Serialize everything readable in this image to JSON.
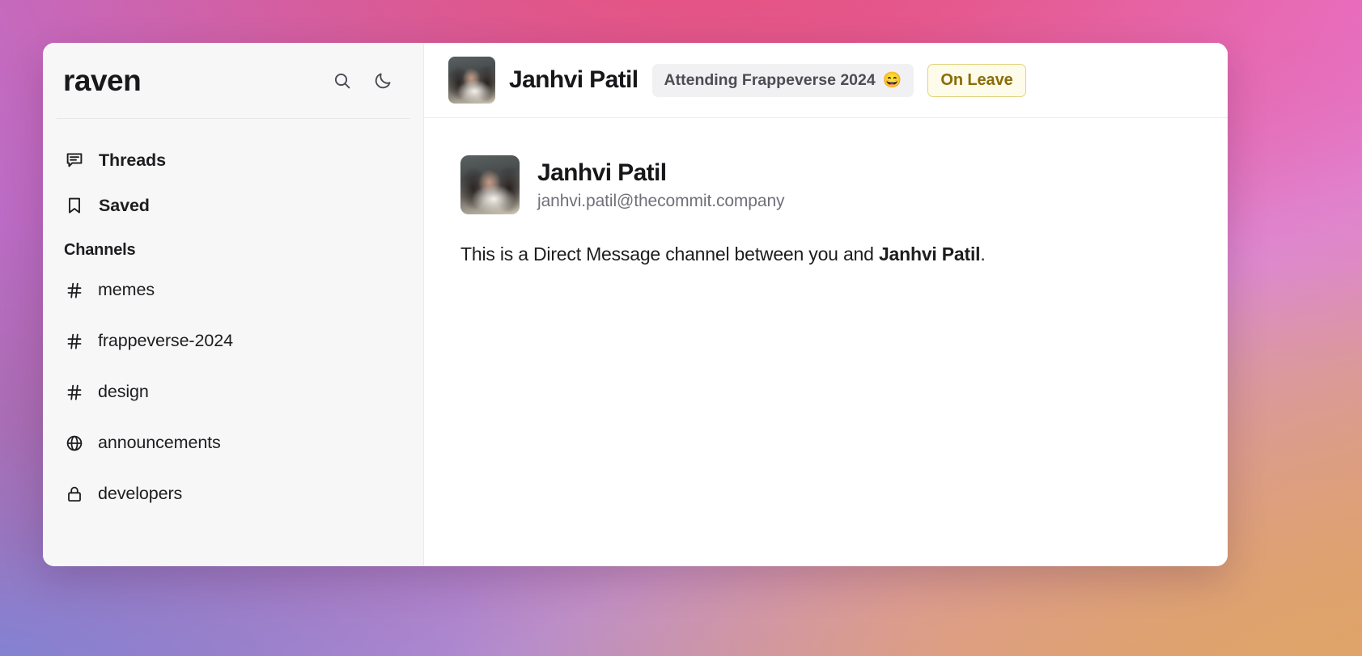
{
  "app": {
    "brand": "raven"
  },
  "sidebar": {
    "icons": [
      {
        "name": "search-icon",
        "label": "Search"
      },
      {
        "name": "moon-icon",
        "label": "Dark mode"
      }
    ],
    "nav": [
      {
        "icon": "threads-icon",
        "label": "Threads"
      },
      {
        "icon": "bookmark-icon",
        "label": "Saved"
      }
    ],
    "section_title": "Channels",
    "channels": [
      {
        "icon": "hash-icon",
        "label": "memes"
      },
      {
        "icon": "hash-icon",
        "label": "frappeverse-2024"
      },
      {
        "icon": "hash-icon",
        "label": "design"
      },
      {
        "icon": "globe-icon",
        "label": "announcements"
      },
      {
        "icon": "lock-icon",
        "label": "developers"
      }
    ]
  },
  "main": {
    "header": {
      "avatar_alt": "Janhvi Patil",
      "name": "Janhvi Patil",
      "status_text": "Attending Frappeverse 2024",
      "status_emoji": "😄",
      "badge": "On Leave",
      "badge_color": "#8a6d09",
      "badge_bg": "#fdfbea",
      "badge_border": "#e3d27c"
    },
    "profile": {
      "avatar_alt": "Janhvi Patil",
      "name": "Janhvi Patil",
      "email": "janhvi.patil@thecommit.company"
    },
    "description": {
      "prefix": "This is a Direct Message channel between you and ",
      "bold_name": "Janhvi Patil",
      "suffix": "."
    }
  }
}
